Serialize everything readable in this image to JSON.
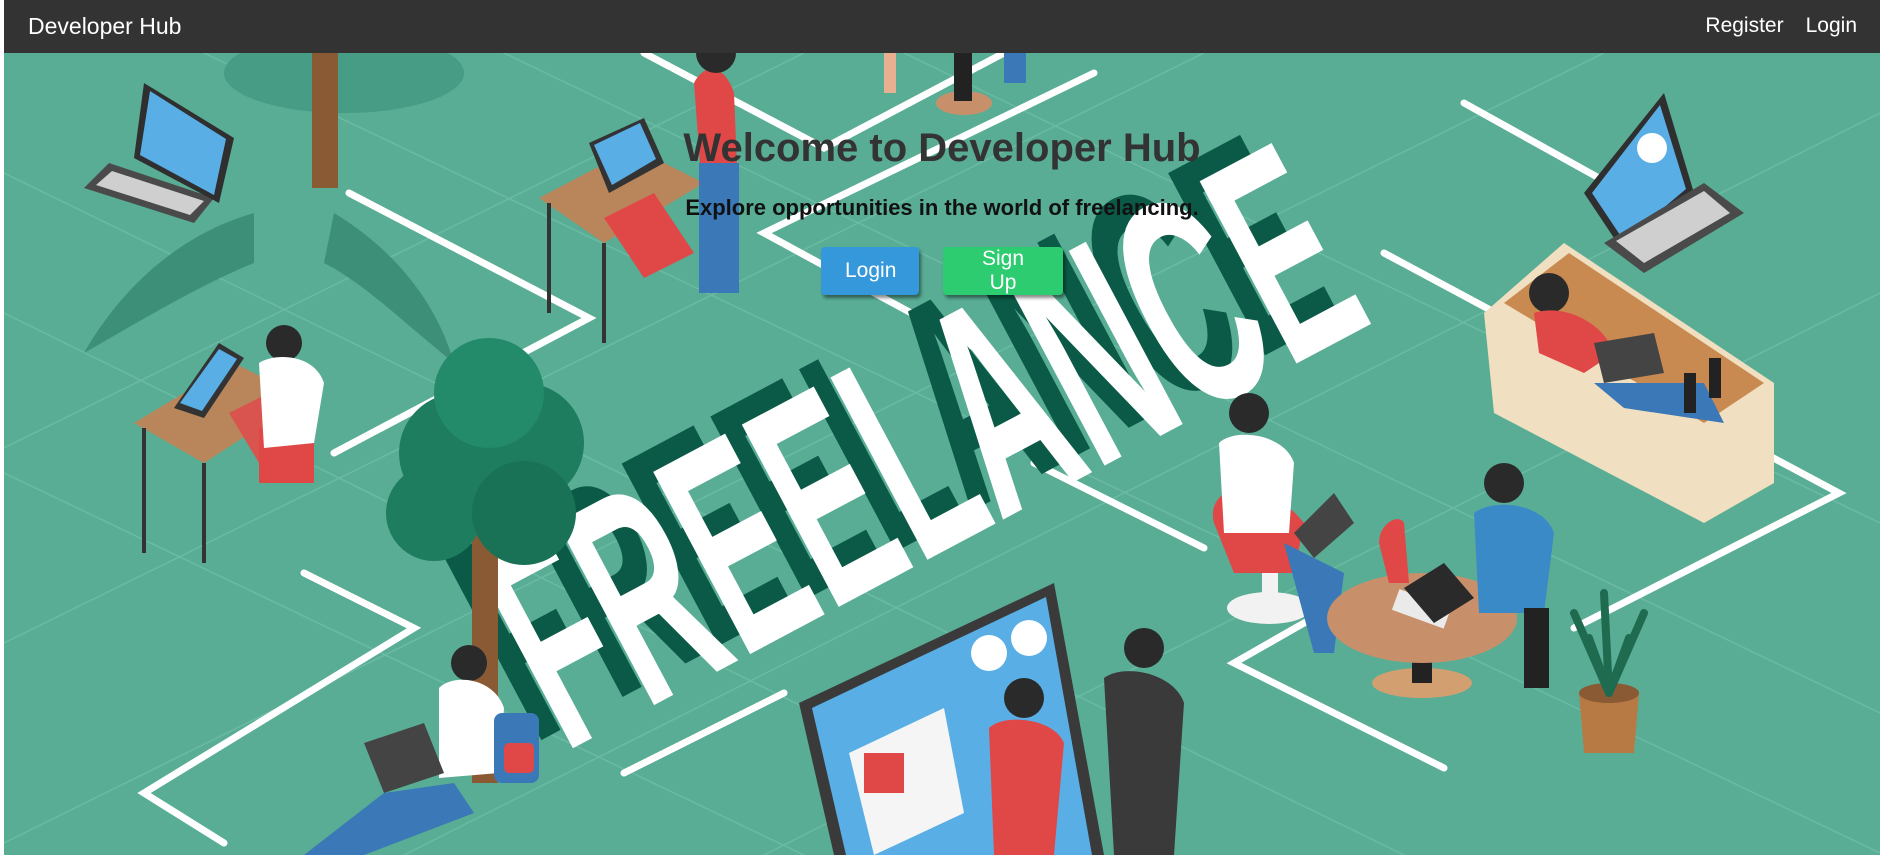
{
  "navbar": {
    "brand": "Developer Hub",
    "links": [
      {
        "label": "Register"
      },
      {
        "label": "Login"
      }
    ]
  },
  "hero": {
    "title": "Welcome to Developer Hub",
    "subtitle": "Explore opportunities in the world of freelancing.",
    "login_label": "Login",
    "signup_label": "Sign Up",
    "background_word": "FREELANCE",
    "colors": {
      "background": "#59ad95",
      "login_button": "#3498db",
      "signup_button": "#2ecc71",
      "navbar": "#333333"
    }
  }
}
